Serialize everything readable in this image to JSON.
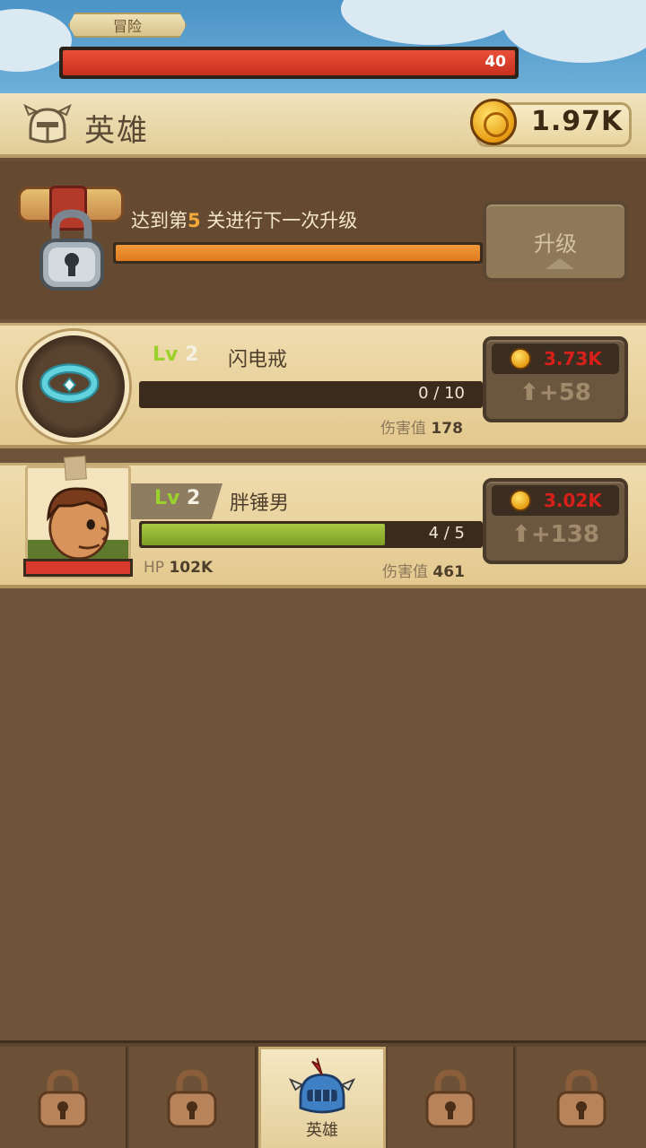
{
  "top": {
    "adventure_tab": "冒险",
    "enemy_hp_value": "40"
  },
  "header": {
    "title": "英雄",
    "gold": "1.97K"
  },
  "lock_panel": {
    "message_prefix": "达到第",
    "message_stage": "5",
    "message_suffix": " 关进行下一次升级",
    "upgrade_label": "升级"
  },
  "items": [
    {
      "type": "ring",
      "lv_prefix": "Lv",
      "level": "2",
      "name": "闪电戒",
      "progress_text": "0 / 10",
      "progress": 0.0,
      "damage_label": "伤害值",
      "damage_value": "178",
      "cost": "3.73K",
      "gain": "+58"
    },
    {
      "type": "hero",
      "lv_prefix": "Lv",
      "level": "2",
      "name": "胖锤男",
      "progress_text": "4 / 5",
      "progress": 0.8,
      "hp_label": "HP",
      "hp_value": "102K",
      "damage_label": "伤害值",
      "damage_value": "461",
      "cost": "3.02K",
      "gain": "+138"
    }
  ],
  "bottom_nav": {
    "active_label": "英雄"
  },
  "colors": {
    "accent_green": "#9bd12d",
    "cost_red": "#d8201b",
    "stage_orange": "#f2a93a"
  }
}
